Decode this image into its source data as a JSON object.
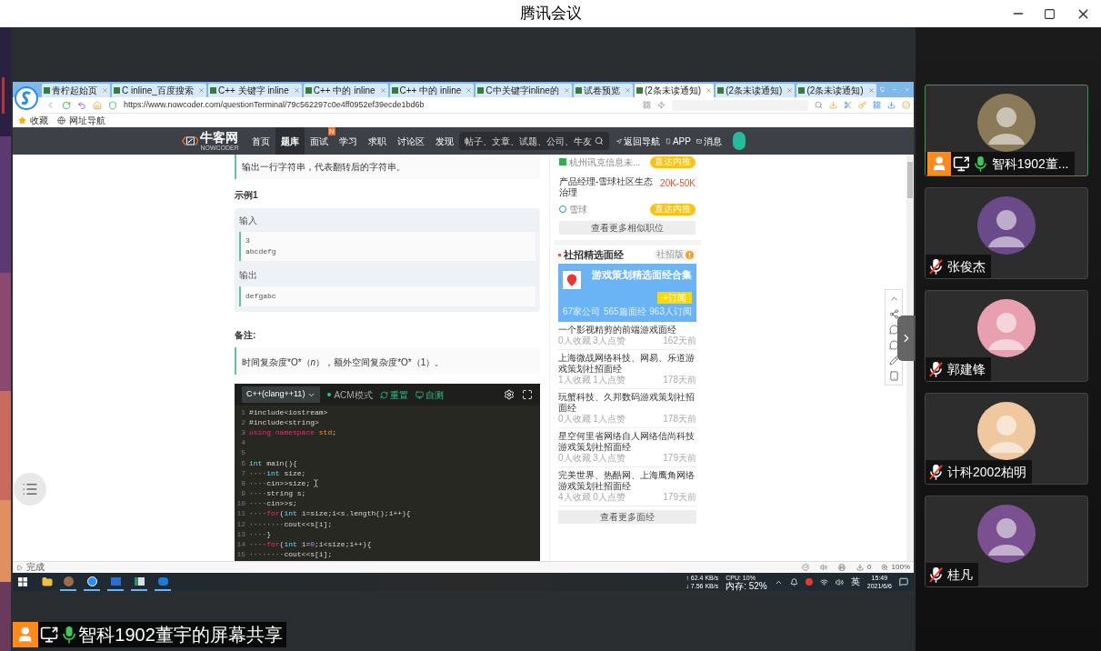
{
  "window": {
    "title": "腾讯会议"
  },
  "browser": {
    "tabs": [
      {
        "label": "青柠起始页",
        "selected": false
      },
      {
        "label": "C inline_百度搜索",
        "selected": false
      },
      {
        "label": "C++ 关键字 inline",
        "selected": false
      },
      {
        "label": "C++ 中的 inline",
        "selected": false
      },
      {
        "label": "C++ 中的 inline",
        "selected": false
      },
      {
        "label": "C中关键字inline的",
        "selected": false
      },
      {
        "label": "试卷预览",
        "selected": false
      },
      {
        "label": "(2条未读通知)",
        "selected": true
      },
      {
        "label": "(2条未读通知)",
        "selected": false
      },
      {
        "label": "(2条未读通知)",
        "selected": false
      }
    ],
    "url": "https://www.nowcoder.com/questionTerminal/79c562297c0e4ff0952ef39ecde1bd6b",
    "bookmarks": [
      "收藏",
      "网址导航"
    ],
    "status": "完成",
    "status_count": "0",
    "zoom": "100%"
  },
  "site": {
    "logo": "牛客网",
    "logo_sub": "NOWCODER",
    "nav": [
      {
        "label": "首页",
        "selected": false
      },
      {
        "label": "题库",
        "selected": true
      },
      {
        "label": "面试",
        "selected": false,
        "badge": "N"
      },
      {
        "label": "学习",
        "selected": false
      },
      {
        "label": "求职",
        "selected": false
      },
      {
        "label": "讨论区",
        "selected": false
      },
      {
        "label": "发现",
        "selected": false
      }
    ],
    "search": {
      "placeholder": "帖子、文章、试题、公司、牛友"
    },
    "links": [
      "返回导航",
      "APP",
      "消息"
    ]
  },
  "problem": {
    "output_desc": "输出一行字符串，代表翻转后的字符串。",
    "example_title": "示例1",
    "input_label": "输入",
    "input_lines": [
      "3",
      "abcdefg"
    ],
    "output_label": "输出",
    "output_lines": [
      "defgabc"
    ],
    "note_title": "备注:",
    "note": "时间复杂度*O*（*n*），额外空间复杂度*O*（1）。"
  },
  "editor": {
    "language": "C++(clang++11)",
    "mode": "ACM模式",
    "actions": [
      "重置",
      "自测"
    ],
    "lines": [
      {
        "number": "1",
        "tokens": [
          {
            "text": "#include<iostream>",
            "kind": "plain"
          }
        ]
      },
      {
        "number": "2",
        "tokens": [
          {
            "text": "#include<string>",
            "kind": "plain"
          }
        ]
      },
      {
        "number": "3",
        "tokens": [
          {
            "text": "using namespace",
            "kind": "keyword"
          },
          {
            "text": " std",
            "kind": "name"
          },
          {
            "text": ";",
            "kind": "plain"
          }
        ]
      },
      {
        "number": "4"
      },
      {
        "number": "5"
      },
      {
        "number": "6",
        "tokens": [
          {
            "text": "int",
            "kind": "type"
          },
          {
            "text": " main(){",
            "kind": "plain"
          }
        ]
      },
      {
        "number": "7",
        "tokens": [
          {
            "text": "····",
            "kind": "ws"
          },
          {
            "text": "int",
            "kind": "type"
          },
          {
            "text": " size;",
            "kind": "plain"
          }
        ]
      },
      {
        "number": "8",
        "tokens": [
          {
            "text": "····",
            "kind": "ws"
          },
          {
            "text": "cin>>size;",
            "kind": "plain"
          }
        ],
        "cursor": true
      },
      {
        "number": "9",
        "tokens": [
          {
            "text": "····",
            "kind": "ws"
          },
          {
            "text": "string s;",
            "kind": "plain"
          }
        ]
      },
      {
        "number": "10",
        "tokens": [
          {
            "text": "····",
            "kind": "ws"
          },
          {
            "text": "cin>>s;",
            "kind": "plain"
          }
        ]
      },
      {
        "number": "11",
        "tokens": [
          {
            "text": "····",
            "kind": "ws"
          },
          {
            "text": "for",
            "kind": "keyword"
          },
          {
            "text": "(",
            "kind": "plain"
          },
          {
            "text": "int",
            "kind": "type"
          },
          {
            "text": " i=size;i<s.length();i++){",
            "kind": "plain"
          }
        ]
      },
      {
        "number": "12",
        "tokens": [
          {
            "text": "········",
            "kind": "ws"
          },
          {
            "text": "cout<<s[i];",
            "kind": "plain"
          }
        ]
      },
      {
        "number": "13",
        "tokens": [
          {
            "text": "····",
            "kind": "ws"
          },
          {
            "text": "}",
            "kind": "plain"
          }
        ]
      },
      {
        "number": "14",
        "tokens": [
          {
            "text": "····",
            "kind": "ws"
          },
          {
            "text": "for",
            "kind": "keyword"
          },
          {
            "text": "(",
            "kind": "plain"
          },
          {
            "text": "int",
            "kind": "type"
          },
          {
            "text": " i=",
            "kind": "plain"
          },
          {
            "text": "0",
            "kind": "number"
          },
          {
            "text": ";i<size;i++){",
            "kind": "plain"
          }
        ]
      },
      {
        "number": "15",
        "tokens": [
          {
            "text": "········",
            "kind": "ws"
          },
          {
            "text": "cout<<s[i];",
            "kind": "plain"
          }
        ]
      }
    ]
  },
  "sidebar": {
    "jobs": [
      {
        "company": "杭州讯克信息未...",
        "button": "直达内推"
      },
      {
        "title": "产品经理-雪球社区生态治理",
        "salary": "20K-50K",
        "company": "雪球",
        "button": "直达内推"
      }
    ],
    "more_jobs": "查看更多相似职位",
    "section_title": "社招精选面经",
    "section_tag": "社招版",
    "feature": {
      "title": "游戏策划精选面经合集",
      "button": "+订阅",
      "stats": [
        "67家公司",
        "565篇面经",
        "963人订阅"
      ]
    },
    "posts": [
      {
        "title": "一个影视精剪的前端游戏面经",
        "meta": "0人收藏 3人点赞",
        "age": "162天前"
      },
      {
        "title": "上海微战网络科技、网易、乐道游戏策划社招面经",
        "meta": "1人收藏 1人点赞",
        "age": "178天前"
      },
      {
        "title": "玩蟹科技、久邦数码游戏策划社招面经",
        "meta": "0人收藏 1人点赞",
        "age": "178天前"
      },
      {
        "title": "星空何里省网络自人网络信尚科技游戏策划社招面经",
        "meta": "0人收藏 3人点赞",
        "age": "179天前"
      },
      {
        "title": "完美世界、热酷网、上海鹰角网络游戏策划社招面经",
        "meta": "4人收藏 0人点赞",
        "age": "179天前"
      }
    ],
    "more_posts": "查看更多面经"
  },
  "taskbar": {
    "upload": "↑ 62.4 KB/s",
    "download": "↓ 7.56 KB/s",
    "cpu": "CPU: 10%",
    "memory": "内存: 52%",
    "ime": "英",
    "time": "15:49",
    "date": "2021/6/6"
  },
  "participants": [
    {
      "name": "智科1902董...",
      "selected": true,
      "host": true,
      "sharing": true,
      "muted": false
    },
    {
      "name": "张俊杰",
      "selected": false,
      "host": false,
      "sharing": false,
      "muted": true
    },
    {
      "name": "郭建锋",
      "selected": false,
      "host": false,
      "sharing": false,
      "muted": true
    },
    {
      "name": "计科2002柏明",
      "selected": false,
      "host": false,
      "sharing": false,
      "muted": true
    },
    {
      "name": "桂凡",
      "selected": false,
      "host": false,
      "sharing": false,
      "muted": true
    }
  ],
  "share_caption": {
    "text": "智科1902董宇的屏幕共享",
    "host": true,
    "sharing": true,
    "muted": false
  }
}
